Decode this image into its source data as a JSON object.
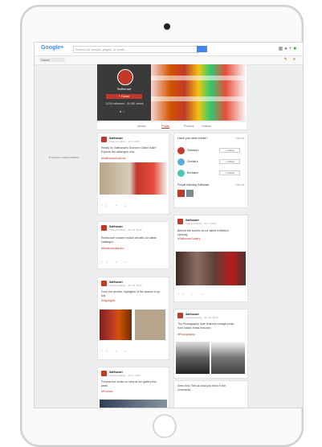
{
  "toolbar": {
    "logo": "Google+",
    "search_placeholder": "Search for people, pages, or posts",
    "icons": [
      "apps-icon",
      "notifications-icon",
      "share-icon",
      "account-icon"
    ]
  },
  "subbar": {
    "home": "Home",
    "tools": "✎ ≡"
  },
  "left_label": "Explore communities",
  "profile": {
    "name": "Saffronart",
    "follow": "+ Follow",
    "meta": "3,024 followers · 44,901 views",
    "dots": "● ○"
  },
  "tabs": [
    "About",
    "Posts",
    "Photos",
    "Videos"
  ],
  "posts_left": [
    {
      "name": "Saffronart",
      "date": "Shared publicly · Jul 3, 2015",
      "text": "Ready for Saffronart’s Summer Online Sale? Explore the catalogue now",
      "link": "#SaffronartAuctions",
      "actions": "+1 ↗ ☺"
    },
    {
      "name": "Saffronart",
      "date": "Shared publicly · Jun 24, 2015",
      "text": "Rediscover modern Indian art with our latest catalogue",
      "link": "#ModernIndianArt",
      "actions": "+1 ↗ ☺"
    },
    {
      "name": "Saffronart",
      "date": "Shared publicly · Jun 15, 2015",
      "text": "From the archive: highlights of the season’s top lots",
      "link": "#Highlights",
      "actions": "+1 ↗ ☺"
    },
    {
      "name": "Saffronart",
      "date": "Shared publicly · Jun 2, 2015",
      "text": "Preview the works on view at our gallery this week",
      "link": "#Preview",
      "actions": "+1 ↗ ☺"
    }
  ],
  "sidebox": {
    "title": "Have you seen these?",
    "more": "View all",
    "suggestions": [
      {
        "name": "Sotheby’s",
        "follow": "+ Follow",
        "color": "#c0392b"
      },
      {
        "name": "Christie’s",
        "follow": "+ Follow",
        "color": "#5dade2"
      },
      {
        "name": "Bonhams",
        "follow": "+ Follow",
        "color": "#48c9b0"
      }
    ],
    "people_title": "People following Saffronart",
    "people_more": "View all"
  },
  "posts_right": [
    {
      "name": "Saffronart",
      "date": "Shared publicly · Jul 1, 2015",
      "text": "Behind the scenes at our latest exhibition opening",
      "link": "#SaffronartGallery",
      "actions": "+1 ↗ ☺"
    },
    {
      "name": "Saffronart",
      "date": "Shared publicly · Jun 20, 2015",
      "text": "The Photography Sale features vintage prints from India’s finest lensmen",
      "link": "#Photography",
      "actions": "+1 ↗ ☺"
    },
    {
      "name": "Saffronart",
      "date": "",
      "text": "Seen this? Tell us what you think in the comments",
      "link": "",
      "actions": ""
    }
  ]
}
